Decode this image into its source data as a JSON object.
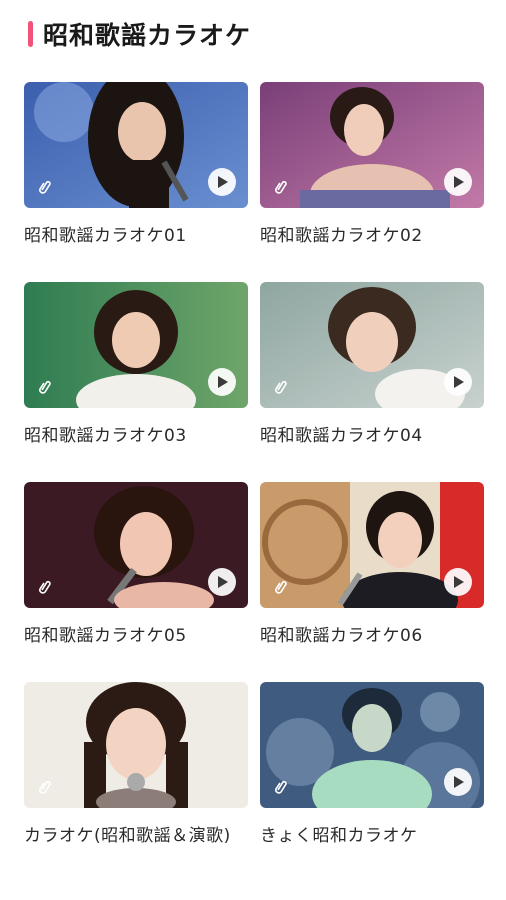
{
  "header": {
    "title": "昭和歌謡カラオケ",
    "accent_color": "#f0527a"
  },
  "cards": [
    {
      "title": "昭和歌謡カラオケ01",
      "icon": "play-icon"
    },
    {
      "title": "昭和歌謡カラオケ02",
      "icon": "play-icon"
    },
    {
      "title": "昭和歌謡カラオケ03",
      "icon": "play-icon"
    },
    {
      "title": "昭和歌謡カラオケ04",
      "icon": "play-icon"
    },
    {
      "title": "昭和歌謡カラオケ05",
      "icon": "play-icon"
    },
    {
      "title": "昭和歌謡カラオケ06",
      "icon": "play-icon"
    },
    {
      "title": "カラオケ(昭和歌謡＆演歌)",
      "icon": "play-icon"
    },
    {
      "title": "きょく昭和カラオケ",
      "icon": "play-icon"
    }
  ]
}
